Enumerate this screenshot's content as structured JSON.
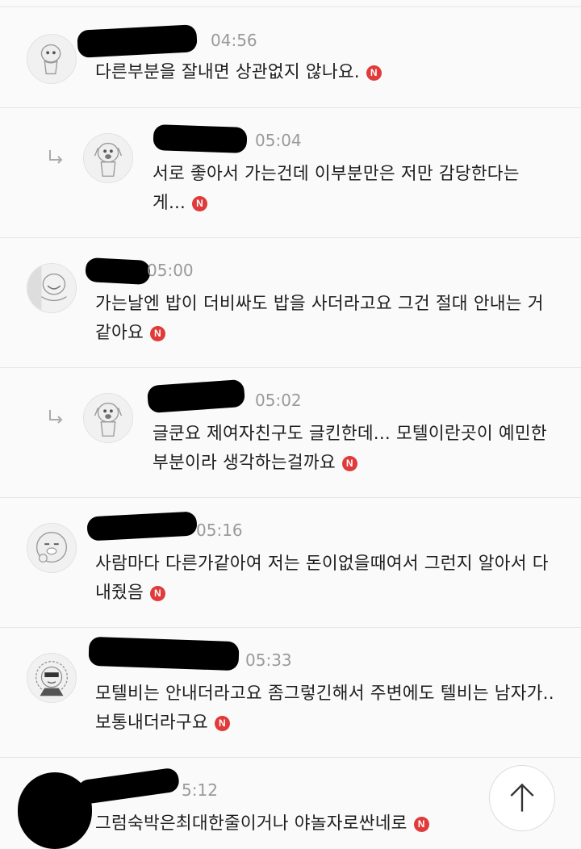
{
  "comments": [
    {
      "time": "04:56",
      "text": "다른부분을 잘내면 상관없지 않나요.",
      "badge": "N",
      "reply": false
    },
    {
      "time": "05:04",
      "text": "서로 좋아서 가는건데 이부분만은 저만 감당한다는 게...",
      "badge": "N",
      "reply": true
    },
    {
      "time": "05:00",
      "text": "가는날엔 밥이 더비싸도 밥을 사더라고요 그건 절대 안내는 거같아요",
      "badge": "N",
      "reply": false
    },
    {
      "time": "05:02",
      "text": "글쿤요 제여자친구도 글킨한데... 모텔이란곳이 예민한부분이라 생각하는걸까요",
      "badge": "N",
      "reply": true
    },
    {
      "time": "05:16",
      "text": "사람마다 다른가같아여 저는 돈이없을때여서 그런지 알아서 다내줬음",
      "badge": "N",
      "reply": false
    },
    {
      "time": "05:33",
      "text": "모텔비는 안내더라고요 좀그렇긴해서 주변에도 텔비는 남자가..보통내더라구요",
      "badge": "N",
      "reply": false
    },
    {
      "time": "5:12",
      "text": "그럼숙박은최대한줄이거나 야놀자로싼네로",
      "badge": "N",
      "reply": false
    }
  ],
  "icons": {
    "reply": "reply-arrow-icon",
    "scroll_top": "arrow-up-icon"
  },
  "colors": {
    "badge": "#e03a3a",
    "time": "#9a9a9a",
    "divider": "#e6e6e6"
  }
}
